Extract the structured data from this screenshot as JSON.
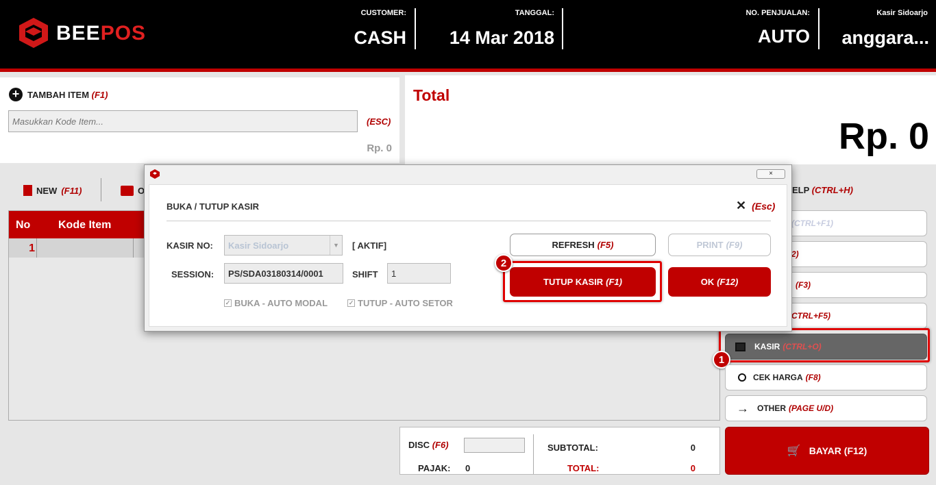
{
  "header": {
    "brand_bee": "BEE",
    "brand_pos": "POS",
    "customer_label": "CUSTOMER:",
    "customer_value": "CASH",
    "date_label": "TANGGAL:",
    "date_value": "14 Mar 2018",
    "sale_no_label": "NO. PENJUALAN:",
    "sale_no_value": "AUTO",
    "cashier_label": "Kasir Sidoarjo",
    "cashier_value": "anggara..."
  },
  "add_item": {
    "label": "TAMBAH ITEM",
    "shortcut": "(F1)",
    "placeholder": "Masukkan Kode Item...",
    "esc": "(ESC)",
    "price": "Rp. 0"
  },
  "total": {
    "label": "Total",
    "amount": "Rp. 0"
  },
  "toolbar": {
    "new_label": "NEW",
    "new_shortcut": "(F11)",
    "open_label": "O",
    "help_label": "ELP",
    "help_shortcut": "(CTRL+H)"
  },
  "table": {
    "headers": {
      "no": "No",
      "code": "Kode Item"
    },
    "rows": [
      {
        "no": "1"
      }
    ]
  },
  "right_buttons": {
    "b1": "(CTRL+F1)",
    "b2": "2)",
    "b3": "(F3)",
    "b4": "CTRL+F5)",
    "kasir_label": "KASIR",
    "kasir_shortcut": "(CTRL+O)",
    "cek_label": "CEK HARGA",
    "cek_shortcut": "(F8)",
    "other_label": "OTHER",
    "other_shortcut": "(PAGE U/D)",
    "bayar_label": "BAYAR (F12)"
  },
  "summary": {
    "disc_label": "DISC",
    "disc_shortcut": "(F6)",
    "pajak_label": "PAJAK:",
    "pajak_value": "0",
    "subtotal_label": "SUBTOTAL:",
    "subtotal_value": "0",
    "total_label": "TOTAL:",
    "total_value": "0"
  },
  "modal": {
    "title": "BUKA / TUTUP KASIR",
    "close_shortcut": "(Esc)",
    "kasir_no_label": "KASIR NO:",
    "kasir_no_value": "Kasir Sidoarjo",
    "status": "[ AKTIF]",
    "session_label": "SESSION:",
    "session_value": "PS/SDA03180314/0001",
    "shift_label": "SHIFT",
    "shift_value": "1",
    "buka_check": "BUKA - AUTO MODAL",
    "tutup_check": "TUTUP - AUTO SETOR",
    "refresh_label": "REFRESH",
    "refresh_shortcut": "(F5)",
    "print_label": "PRINT",
    "print_shortcut": "(F9)",
    "tutup_label": "TUTUP KASIR",
    "tutup_shortcut": "(F1)",
    "ok_label": "OK",
    "ok_shortcut": "(F12)"
  },
  "steps": {
    "one": "1",
    "two": "2"
  },
  "colors": {
    "brand_red": "#c00000",
    "header_bg": "#000000",
    "kasir_button_bg": "#666666"
  }
}
